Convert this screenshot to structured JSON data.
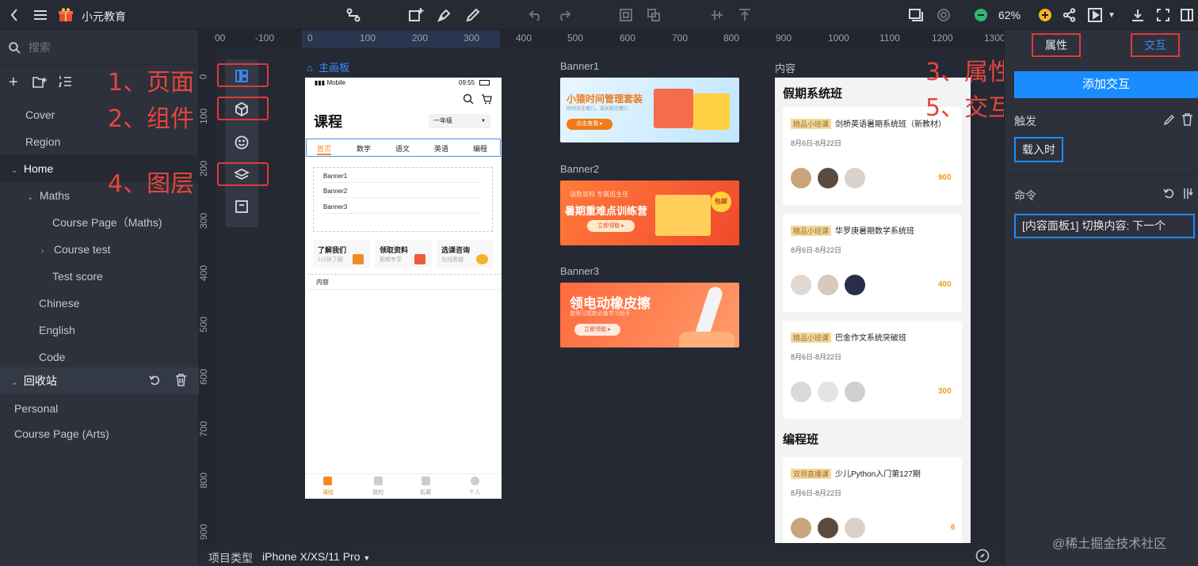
{
  "app": {
    "title": "小元教育",
    "zoom": "62%"
  },
  "sidebar": {
    "search_placeholder": "搜索",
    "pages": [
      {
        "label": "Cover"
      },
      {
        "label": "Region"
      },
      {
        "label": "Home"
      },
      {
        "label": "Maths"
      },
      {
        "label": "Course Page（Maths)"
      },
      {
        "label": "Course test"
      },
      {
        "label": "Test score"
      },
      {
        "label": "Chinese"
      },
      {
        "label": "English"
      },
      {
        "label": "Code"
      }
    ],
    "trash": {
      "label": "回收站",
      "items": [
        {
          "label": "Personal"
        },
        {
          "label": "Course Page (Arts)"
        }
      ]
    }
  },
  "annotations": {
    "page": "1、页面",
    "component": "2、组件",
    "property": "3、属性",
    "layer": "4、图层",
    "interaction": "5、交互"
  },
  "rulers": {
    "h": [
      "00",
      "-100",
      "0",
      "100",
      "200",
      "300",
      "400",
      "500",
      "600",
      "700",
      "800",
      "900",
      "1000",
      "1100",
      "1200",
      "1300"
    ],
    "v": [
      "0",
      "100",
      "200",
      "300",
      "400",
      "500",
      "600",
      "700",
      "800",
      "900"
    ]
  },
  "canvas": {
    "main_board_label": "主画板",
    "banner1_label": "Banner1",
    "banner2_label": "Banner2",
    "banner3_label": "Banner3",
    "content_label": "内容",
    "banner1_text": "小猿时间管理套装",
    "banner1_sub": "时间花在哪儿，成长就在哪儿",
    "banner1_btn": "点击查看 ▸",
    "banner2_top": "语数双科 专属班主任",
    "banner2_text": "暑期重难点训练营",
    "banner2_btn": "立即领取 ▸",
    "banner2_badge": "包邮",
    "banner3_text": "领电动橡皮擦",
    "banner3_sub": "整理习惯新必备学习助手",
    "banner3_btn": "立即领取 ▸"
  },
  "phone": {
    "carrier": "Mobile",
    "time": "09:55",
    "title": "课程",
    "grade": "一年级",
    "tabs": [
      "首页",
      "数学",
      "语文",
      "英语",
      "编程"
    ],
    "banners": [
      "Banner1",
      "Banner2",
      "Banner3"
    ],
    "quick": [
      {
        "title": "了解我们",
        "sub": "1分钟了解"
      },
      {
        "title": "领取资料",
        "sub": "假期专享"
      },
      {
        "title": "选课咨询",
        "sub": "在线答疑"
      }
    ],
    "content_label": "内容",
    "bottom_nav": [
      "课程",
      "我的",
      "拓展",
      "个人"
    ]
  },
  "content_panel": {
    "section1": "假期系统班",
    "section2": "编程班",
    "courses": [
      {
        "tag": "精品小班课",
        "name": "剑桥英语暑期系统班（新教材）",
        "date": "8月6日-8月22日",
        "price": "900"
      },
      {
        "tag": "精品小班课",
        "name": "华罗庚暑期数学系统班",
        "date": "8月6日-8月22日",
        "price": "400"
      },
      {
        "tag": "精品小班课",
        "name": "巴金作文系统突破班",
        "date": "8月6日-8月22日",
        "price": "300"
      },
      {
        "tag": "双师直播课",
        "name": "少儿Python入门第127期",
        "date": "8月6日-8月22日",
        "price": "6"
      }
    ]
  },
  "right_panel": {
    "tab_property": "属性",
    "tab_interaction": "交互",
    "add_button": "添加交互",
    "trigger_label": "触发",
    "trigger_value": "载入时",
    "command_label": "命令",
    "command_value": "[内容面板1] 切换内容: 下一个"
  },
  "bottom": {
    "project_type_label": "项目类型",
    "device": "iPhone X/XS/11 Pro"
  },
  "watermark": "@稀土掘金技术社区",
  "colors": {
    "accent": "#1a8cff",
    "annotation": "#e03a3a",
    "price": "#f39a1e"
  }
}
